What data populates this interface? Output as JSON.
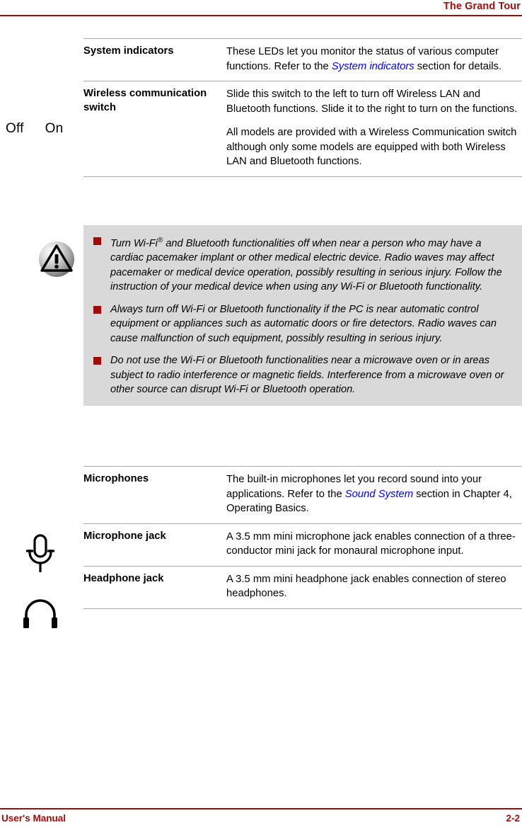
{
  "header": {
    "title": "The Grand Tour",
    "rule_color": "#9E0B0B"
  },
  "footer": {
    "left_label": "User's Manual",
    "page_number": "2-2"
  },
  "margin_labels": {
    "switch_off": "Off",
    "switch_on": "On"
  },
  "icons": {
    "caution": "caution-triangle-icon",
    "microphone": "microphone-icon",
    "headphone": "headphone-icon"
  },
  "colors": {
    "accent_red": "#9E0B0B",
    "link_blue": "#0000FF",
    "warning_bg": "#d9d9d9",
    "rule_gray": "#a8a8a8"
  },
  "table_top": {
    "rows": [
      {
        "term": "System indicators",
        "paragraphs": [
          {
            "parts": [
              {
                "type": "text",
                "value": "These LEDs let you monitor the status of various computer functions. Refer to the "
              },
              {
                "type": "xref",
                "value": "System indicators"
              },
              {
                "type": "text",
                "value": " section for details."
              }
            ]
          }
        ]
      },
      {
        "term": "Wireless communication switch",
        "paragraphs": [
          {
            "parts": [
              {
                "type": "text",
                "value": "Slide this switch to the left to turn off Wireless LAN and Bluetooth functions. Slide it to the right to turn on the functions."
              }
            ]
          },
          {
            "parts": [
              {
                "type": "text",
                "value": "All models are provided with a Wireless Communication switch although only some models are equipped with both Wireless LAN and Bluetooth functions."
              }
            ]
          }
        ]
      }
    ]
  },
  "warning": {
    "items": [
      {
        "parts": [
          {
            "type": "text",
            "value": "Turn Wi-Fi"
          },
          {
            "type": "sup",
            "value": "®"
          },
          {
            "type": "text",
            "value": " and Bluetooth functionalities off when near a person who may have a cardiac pacemaker implant or other medical electric device. Radio waves may affect pacemaker or medical device operation, possibly resulting in serious injury. Follow the instruction of your medical device when using any Wi-Fi or Bluetooth functionality."
          }
        ]
      },
      {
        "parts": [
          {
            "type": "text",
            "value": "Always turn off Wi-Fi or Bluetooth functionality if the PC is near automatic control equipment or appliances such as automatic doors or fire detectors. Radio waves can cause malfunction of such equipment, possibly resulting in serious injury."
          }
        ]
      },
      {
        "parts": [
          {
            "type": "text",
            "value": "Do not use the Wi-Fi or Bluetooth functionalities near a microwave oven or in areas subject to radio interference or magnetic fields. Interference from a microwave oven or other source can disrupt Wi-Fi or Bluetooth operation."
          }
        ]
      }
    ]
  },
  "table_bottom": {
    "rows": [
      {
        "term": "Microphones",
        "paragraphs": [
          {
            "parts": [
              {
                "type": "text",
                "value": "The built-in microphones let you record sound into your applications. Refer to the "
              },
              {
                "type": "xref",
                "value": "Sound System"
              },
              {
                "type": "text",
                "value": " section in Chapter 4, Operating Basics."
              }
            ]
          }
        ]
      },
      {
        "term": "Microphone jack",
        "paragraphs": [
          {
            "parts": [
              {
                "type": "text",
                "value": "A 3.5 mm mini microphone jack enables connection of a three-conductor mini jack for monaural microphone input."
              }
            ]
          }
        ]
      },
      {
        "term": "Headphone jack",
        "paragraphs": [
          {
            "parts": [
              {
                "type": "text",
                "value": "A 3.5 mm mini headphone jack enables connection of stereo headphones."
              }
            ]
          }
        ]
      }
    ]
  }
}
